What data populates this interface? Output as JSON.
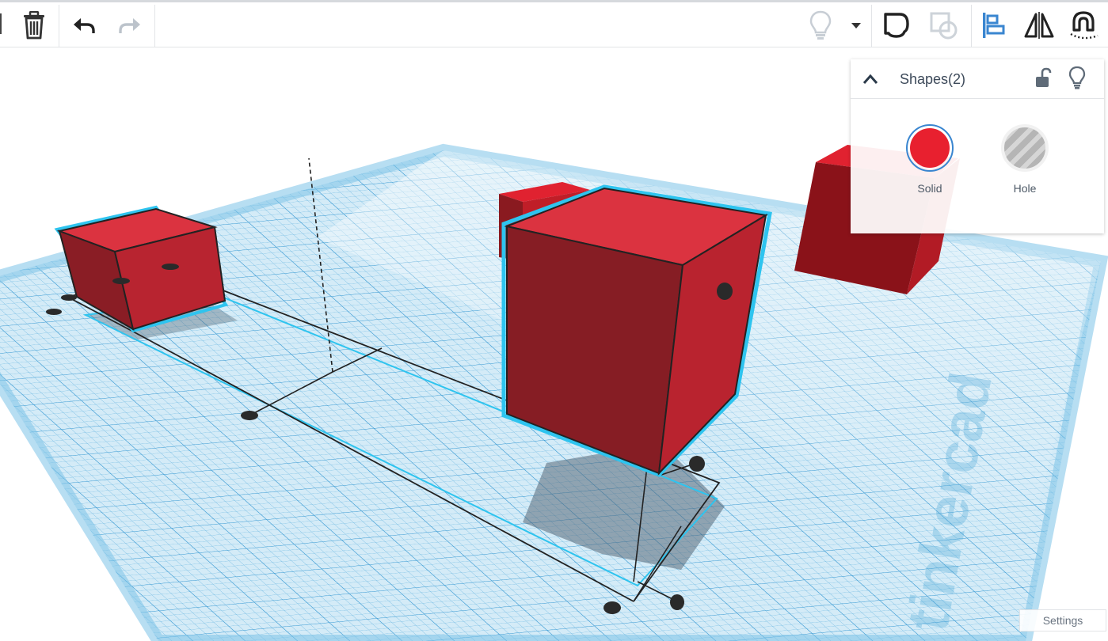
{
  "toolbar": {
    "icons": [
      "trash-icon",
      "undo-icon",
      "redo-icon",
      "lightbulb-icon",
      "dropdown-arrow-icon",
      "group-icon",
      "ungroup-icon",
      "align-icon",
      "mirror-icon",
      "cruise-icon"
    ]
  },
  "inspector": {
    "title": "Shapes(2)",
    "materials": [
      {
        "label": "Solid",
        "color": "#e8202f",
        "selected": true
      },
      {
        "label": "Hole",
        "color": "#b0b0b0",
        "selected": false
      }
    ]
  },
  "workplane": {
    "watermark": "tinkercad",
    "grid_color": "#4fa9d8",
    "shape_color": "#e02230",
    "selection_color": "#2ec4ef"
  },
  "settings_label": "Settings"
}
